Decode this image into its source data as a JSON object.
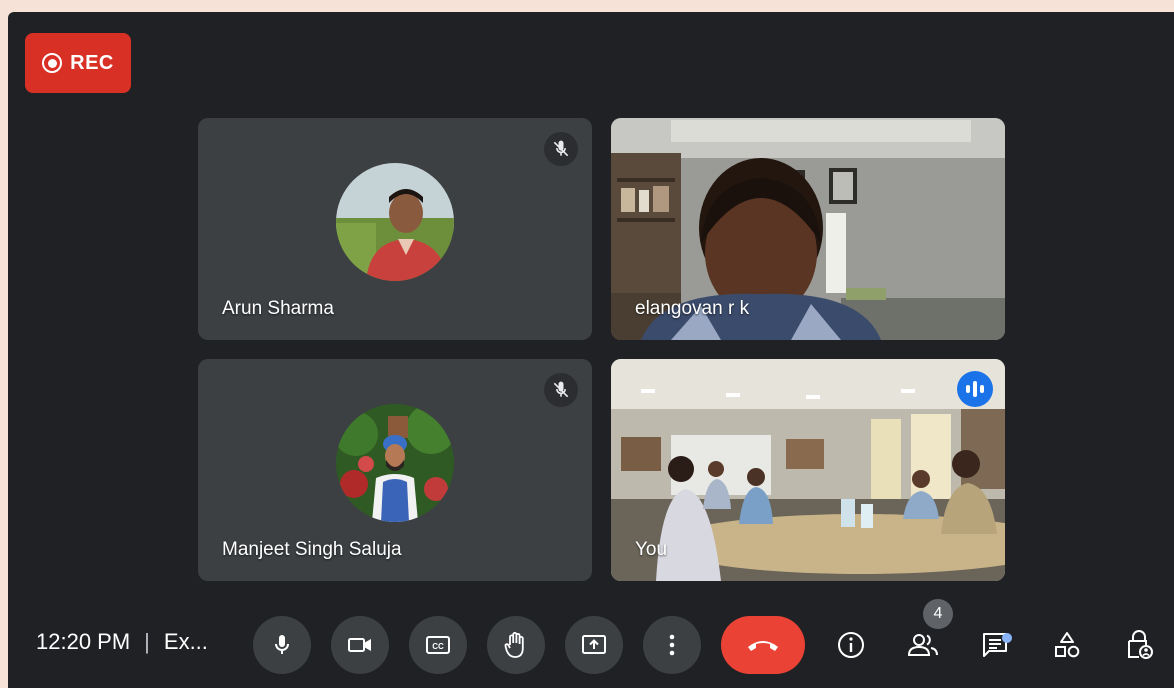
{
  "recording": {
    "label": "REC"
  },
  "participants": [
    {
      "name": "Arun Sharma",
      "muted": true,
      "avatar": "photo"
    },
    {
      "name": "elangovan r k",
      "muted": false,
      "avatar": "video"
    },
    {
      "name": "Manjeet Singh Saluja",
      "muted": true,
      "avatar": "photo"
    },
    {
      "name": "You",
      "muted": false,
      "speaking": true,
      "avatar": "video"
    }
  ],
  "footer": {
    "time": "12:20 PM",
    "separator": "|",
    "meeting_title": "Ex..."
  },
  "controls": [
    {
      "name": "microphone",
      "icon": "mic-icon"
    },
    {
      "name": "camera",
      "icon": "camera-icon"
    },
    {
      "name": "captions",
      "icon": "cc-icon"
    },
    {
      "name": "raise-hand",
      "icon": "hand-icon"
    },
    {
      "name": "present",
      "icon": "present-icon"
    },
    {
      "name": "more-options",
      "icon": "more-vert-icon"
    },
    {
      "name": "leave-call",
      "icon": "hangup-icon"
    }
  ],
  "side_controls": [
    {
      "name": "meeting-details",
      "icon": "info-icon"
    },
    {
      "name": "people",
      "icon": "people-icon",
      "badge": "4"
    },
    {
      "name": "chat",
      "icon": "chat-icon",
      "has_notification": true
    },
    {
      "name": "activities",
      "icon": "activities-icon"
    },
    {
      "name": "host-controls",
      "icon": "lock-person-icon"
    }
  ],
  "colors": {
    "background": "#202124",
    "tile": "#3c4043",
    "rec": "#d93025",
    "hangup": "#ea4335",
    "accent": "#8ab4f8",
    "speaking": "#1a73e8"
  }
}
